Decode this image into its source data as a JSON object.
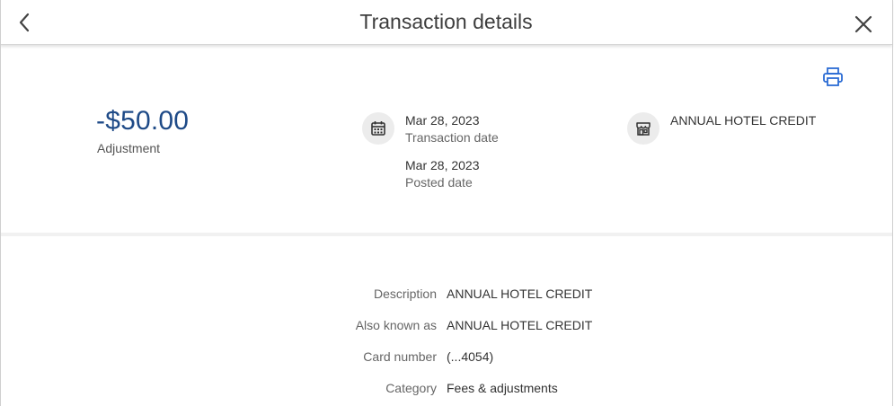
{
  "header": {
    "title": "Transaction details"
  },
  "icons": {
    "back": "chevron-left-icon",
    "close": "close-icon",
    "print": "printer-icon",
    "calendar": "calendar-icon",
    "merchant": "storefront-icon"
  },
  "colors": {
    "amount": "#1e4a87",
    "print_icon": "#2b6cd4"
  },
  "summary": {
    "amount": "-$50.00",
    "amount_type": "Adjustment",
    "transaction_date": "Mar 28, 2023",
    "transaction_date_label": "Transaction date",
    "posted_date": "Mar 28, 2023",
    "posted_date_label": "Posted date",
    "merchant": "ANNUAL HOTEL CREDIT"
  },
  "details": [
    {
      "label": "Description",
      "value": "ANNUAL HOTEL CREDIT"
    },
    {
      "label": "Also known as",
      "value": "ANNUAL HOTEL CREDIT"
    },
    {
      "label": "Card number",
      "value": "(...4054)"
    },
    {
      "label": "Category",
      "value": "Fees & adjustments"
    }
  ]
}
